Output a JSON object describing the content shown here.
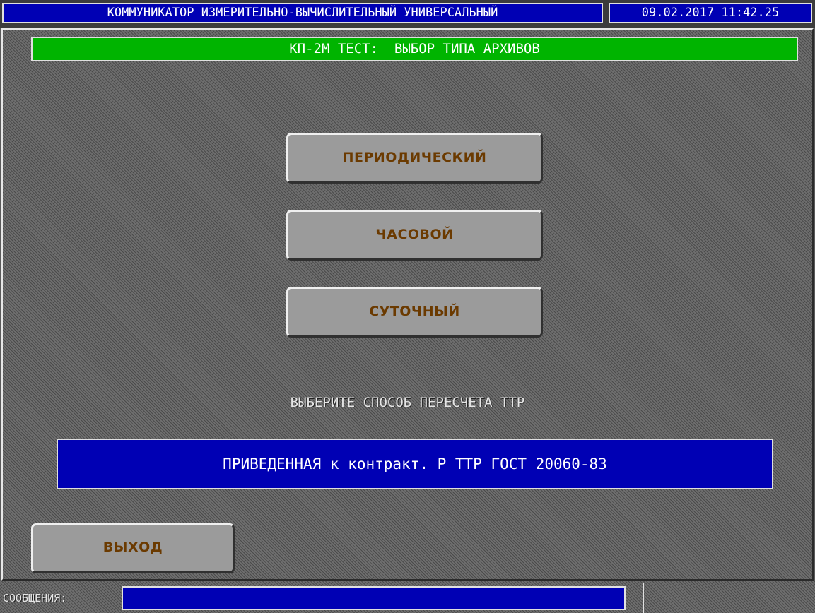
{
  "top_bar": {
    "app_title": "КОММУНИКАТОР ИЗМЕРИТЕЛЬНО-ВЫЧИСЛИТЕЛЬНЫЙ УНИВЕРСАЛЬНЫЙ",
    "datetime": "09.02.2017 11:42.25"
  },
  "screen": {
    "header": "КП-2М ТЕСТ:  ВЫБОР ТИПА АРХИВОВ"
  },
  "archive_types": {
    "periodic_label": "ПЕРИОДИЧЕСКИЙ",
    "hourly_label": "ЧАСОВОЙ",
    "daily_label": "СУТОЧНЫЙ"
  },
  "recalc": {
    "prompt": "ВЫБЕРИТЕ СПОСОБ ПЕРЕСЧЕТА ТТР",
    "selected_method": "ПРИВЕДЕННАЯ к контракт. Р ТТР ГОСТ 20060-83"
  },
  "footer": {
    "exit_label": "ВЫХОД",
    "messages_label": "СООБЩЕНИЯ:",
    "messages_value": ""
  },
  "colors": {
    "field_blue": "#0000b4",
    "header_green": "#00b400",
    "button_gray": "#9b9b9b",
    "button_text": "#6b3a00"
  }
}
